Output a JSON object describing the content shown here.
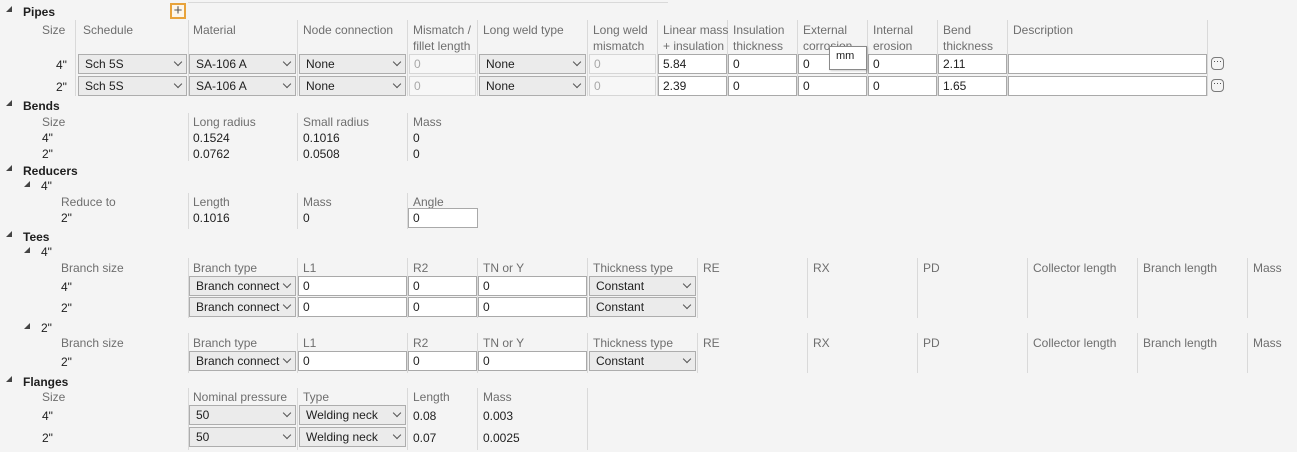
{
  "pipes": {
    "title": "Pipes",
    "headers": {
      "size": "Size",
      "schedule": "Schedule",
      "material": "Material",
      "node_connection": "Node connection",
      "mismatch_1": "Mismatch /",
      "mismatch_2": "fillet length",
      "long_weld_type": "Long weld type",
      "lwm_1": "Long weld",
      "lwm_2": "mismatch",
      "linear_mass_1": "Linear mass",
      "linear_mass_2": "+ insulation",
      "insulation_1": "Insulation",
      "insulation_2": "thickness",
      "external_1": "External",
      "external_2": "corrosion",
      "internal_1": "Internal",
      "internal_2": "erosion",
      "bend_1": "Bend",
      "bend_2": "thickness",
      "description": "Description"
    },
    "rows": [
      {
        "size": "4\"",
        "schedule": "Sch 5S",
        "material": "SA-106 A",
        "node_connection": "None",
        "mismatch": "0",
        "long_weld_type": "None",
        "long_weld_mismatch": "0",
        "linear_mass": "5.84",
        "insulation": "0",
        "external": "0",
        "internal": "0",
        "bend": "2.11",
        "description": ""
      },
      {
        "size": "2\"",
        "schedule": "Sch 5S",
        "material": "SA-106 A",
        "node_connection": "None",
        "mismatch": "0",
        "long_weld_type": "None",
        "long_weld_mismatch": "0",
        "linear_mass": "2.39",
        "insulation": "0",
        "external": "0",
        "internal": "0",
        "bend": "1.65",
        "description": ""
      }
    ],
    "tooltip": "mm",
    "add_icon": "plus-icon",
    "row_action_icon": "ellipsis-icon"
  },
  "bends": {
    "title": "Bends",
    "headers": {
      "size": "Size",
      "long_radius": "Long radius",
      "small_radius": "Small radius",
      "mass": "Mass"
    },
    "rows": [
      {
        "size": "4\"",
        "long_radius": "0.1524",
        "small_radius": "0.1016",
        "mass": "0"
      },
      {
        "size": "2\"",
        "long_radius": "0.0762",
        "small_radius": "0.0508",
        "mass": "0"
      }
    ]
  },
  "reducers": {
    "title": "Reducers",
    "group": "4\"",
    "headers": {
      "reduce_to": "Reduce to",
      "length": "Length",
      "mass": "Mass",
      "angle": "Angle"
    },
    "row": {
      "reduce_to": "2\"",
      "length": "0.1016",
      "mass": "0",
      "angle": "0"
    }
  },
  "tees": {
    "title": "Tees",
    "headers": {
      "branch_size": "Branch size",
      "branch_type": "Branch type",
      "l1": "L1",
      "r2": "R2",
      "tn": "TN or Y",
      "thickness_type": "Thickness type",
      "re": "RE",
      "rx": "RX",
      "pd": "PD",
      "collector_length": "Collector length",
      "branch_length": "Branch length",
      "mass": "Mass"
    },
    "groups": [
      {
        "size": "4\"",
        "rows": [
          {
            "branch_size": "4\"",
            "branch_type": "Branch connect",
            "l1": "0",
            "r2": "0",
            "tn": "0",
            "thickness_type": "Constant"
          },
          {
            "branch_size": "2\"",
            "branch_type": "Branch connect",
            "l1": "0",
            "r2": "0",
            "tn": "0",
            "thickness_type": "Constant"
          }
        ]
      },
      {
        "size": "2\"",
        "rows": [
          {
            "branch_size": "2\"",
            "branch_type": "Branch connect",
            "l1": "0",
            "r2": "0",
            "tn": "0",
            "thickness_type": "Constant"
          }
        ]
      }
    ]
  },
  "flanges": {
    "title": "Flanges",
    "headers": {
      "size": "Size",
      "nominal_pressure": "Nominal pressure",
      "type": "Type",
      "length": "Length",
      "mass": "Mass"
    },
    "rows": [
      {
        "size": "4\"",
        "nominal_pressure": "50",
        "type": "Welding neck",
        "length": "0.08",
        "mass": "0.003"
      },
      {
        "size": "2\"",
        "nominal_pressure": "50",
        "type": "Welding neck",
        "length": "0.07",
        "mass": "0.0025"
      }
    ]
  },
  "colors": {
    "accent": "#e8a33b",
    "background": "#f4f4f4",
    "grid": "#d9d9d9"
  }
}
